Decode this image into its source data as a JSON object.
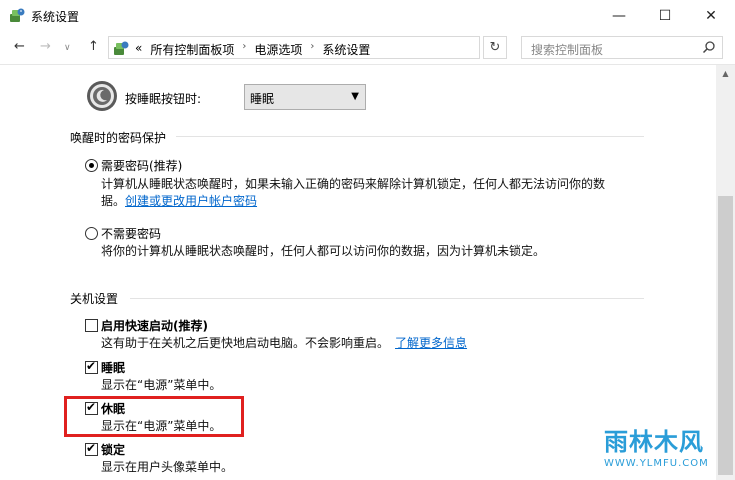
{
  "window": {
    "title": "系统设置",
    "minimize": "—",
    "maximize": "☐",
    "close": "✕"
  },
  "nav": {
    "back": "←",
    "forward": "→",
    "recent": "∨",
    "up": "↑",
    "chevrons": "«",
    "breadcrumbs": [
      "所有控制面板项",
      "电源选项",
      "系统设置"
    ],
    "separator": "›",
    "dropdown": "∨",
    "refresh": "↻",
    "search_placeholder": "搜索控制面板"
  },
  "sleep_button": {
    "label": "按睡眠按钮时:",
    "value": "睡眠",
    "arrow": "▼"
  },
  "password_section": {
    "title": "唤醒时的密码保护",
    "require": {
      "label": "需要密码(推荐)",
      "checked": true,
      "desc_line1": "计算机从睡眠状态唤醒时，如果未输入正确的密码来解除计算机锁定，任何人都无法访问你的数",
      "desc_line2_prefix": "据。",
      "link": "创建或更改用户帐户密码"
    },
    "norequire": {
      "label": "不需要密码",
      "checked": false,
      "desc": "将你的计算机从睡眠状态唤醒时，任何人都可以访问你的数据，因为计算机未锁定。"
    }
  },
  "shutdown_section": {
    "title": "关机设置",
    "fast_startup": {
      "label": "启用快速启动(推荐)",
      "checked": false,
      "desc": "这有助于在关机之后更快地启动电脑。不会影响重启。",
      "link": "了解更多信息"
    },
    "sleep": {
      "label": "睡眠",
      "checked": true,
      "desc": "显示在“电源”菜单中。"
    },
    "hibernate": {
      "label": "休眠",
      "checked": true,
      "desc": "显示在“电源”菜单中。"
    },
    "lock": {
      "label": "锁定",
      "checked": true,
      "desc": "显示在用户头像菜单中。"
    }
  },
  "scrollbar": {
    "up": "▲"
  },
  "watermark": {
    "text": "雨林木风",
    "url": "WWW.YLMFU.COM"
  },
  "colors": {
    "highlight": "#e0201f",
    "link": "#0066cc",
    "watermark": "#2a9dd8"
  }
}
